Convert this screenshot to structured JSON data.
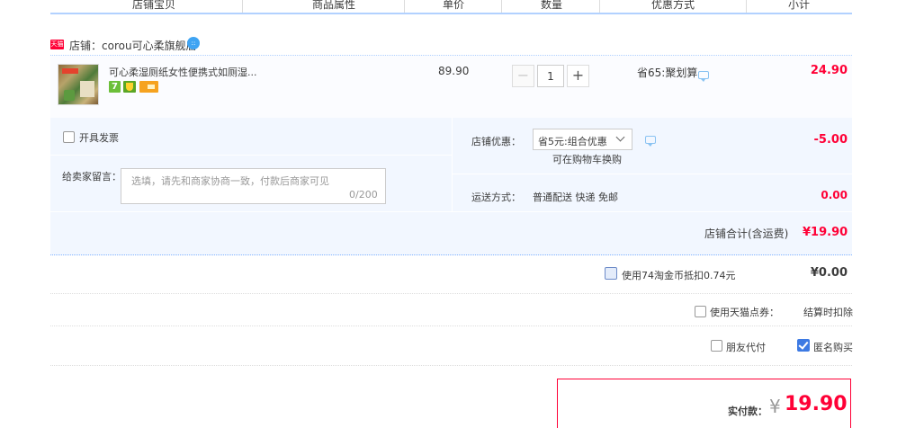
{
  "header": {
    "columns": [
      "店铺宝贝",
      "商品属性",
      "单价",
      "数量",
      "优惠方式",
      "小计"
    ]
  },
  "shop": {
    "tag": "天猫",
    "label": "店铺：",
    "name": "corou可心柔旗舰店"
  },
  "item": {
    "title": "可心柔湿厕纸女性便携式如厕湿...",
    "badge_seven": "7",
    "unit_price": "89.90",
    "quantity": "1",
    "minus": "−",
    "plus": "+",
    "discount": "省65:聚划算",
    "subtotal": "24.90"
  },
  "options": {
    "invoice_label": "开具发票",
    "message_label": "给卖家留言：",
    "message_placeholder": "选填，请先和商家协商一致，付款后商家可见",
    "message_count": "0/200",
    "coupon_label": "店铺优惠：",
    "coupon_selected": "省5元:组合优惠",
    "coupon_note": "可在购物车换购",
    "coupon_amount": "-5.00",
    "shipping_label": "运送方式：",
    "shipping_value": "普通配送 快递 免邮",
    "shipping_amount": "0.00",
    "shop_total_label": "店铺合计(含运费)",
    "shop_total_value": "¥19.90"
  },
  "summary": {
    "coins_label": "使用74淘金币抵扣0.74元",
    "coins_amount": "¥0.00",
    "points_label": "使用天猫点券：",
    "points_value": "结算时扣除",
    "friend_pay_label": "朋友代付",
    "anonymous_label": "匿名购买",
    "anonymous_checked": true,
    "pay_label": "实付款：",
    "pay_currency": "¥",
    "pay_value": "19.90"
  },
  "colors": {
    "accent": "#ff0036",
    "border_blue": "#b2d1ff",
    "panel_bg": "#f2f7ff",
    "checkbox_blue": "#3d7ae3"
  }
}
